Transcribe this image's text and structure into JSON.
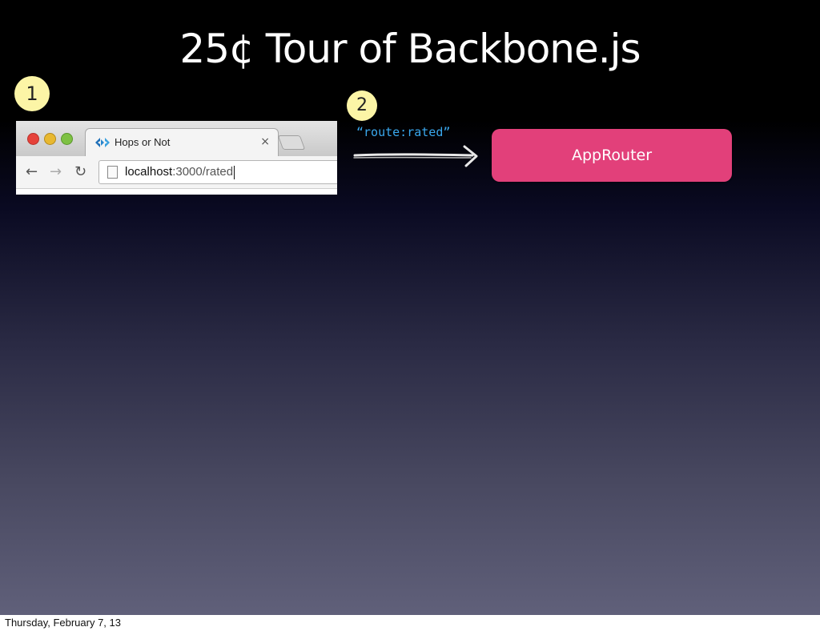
{
  "slide": {
    "title": "25¢ Tour of Backbone.js",
    "step1_badge": "1",
    "step2_badge": "2",
    "route_event": "“route:rated”",
    "approuter_label": "AppRouter"
  },
  "browser": {
    "tab_title": "Hops or Not",
    "tab_close": "×",
    "url_host": "localhost",
    "url_path": ":3000/rated",
    "tab_icon": "backbone-logo-icon"
  },
  "footer": {
    "date": "Thursday, February 7, 13"
  },
  "colors": {
    "badge": "#fcf5a6",
    "approuter": "#e2407a",
    "route_text": "#3aa8ee"
  }
}
